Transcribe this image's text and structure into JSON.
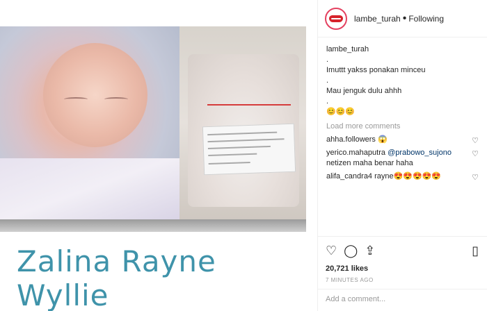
{
  "post": {
    "baby_name_overlay": "Zalina Rayne Wyllie"
  },
  "header": {
    "username": "lambe_turah",
    "separator": "•",
    "following_label": "Following",
    "avatar_icon": "lips-logo-icon"
  },
  "caption": {
    "user": "lambe_turah",
    "lines": [
      ".",
      "Imuttt yakss ponakan minceu",
      ".",
      "Mau jenguk dulu ahhh",
      ".",
      "😊😊😊"
    ]
  },
  "load_more_label": "Load more comments",
  "comments": [
    {
      "user": "ahha.followers",
      "text": "😱"
    },
    {
      "user": "yerico.mahaputra",
      "mention": "@prabowo_sujono",
      "text": "netizen maha benar haha"
    },
    {
      "user": "alifa_candra4",
      "text": "rayne😍😍😍😍😍"
    }
  ],
  "actions": {
    "like_icon": "heart-icon",
    "comment_icon": "comment-icon",
    "share_icon": "share-icon",
    "save_icon": "bookmark-icon"
  },
  "likes_label": "20,721 likes",
  "timestamp": "7 MINUTES AGO",
  "add_comment_placeholder": "Add a comment..."
}
